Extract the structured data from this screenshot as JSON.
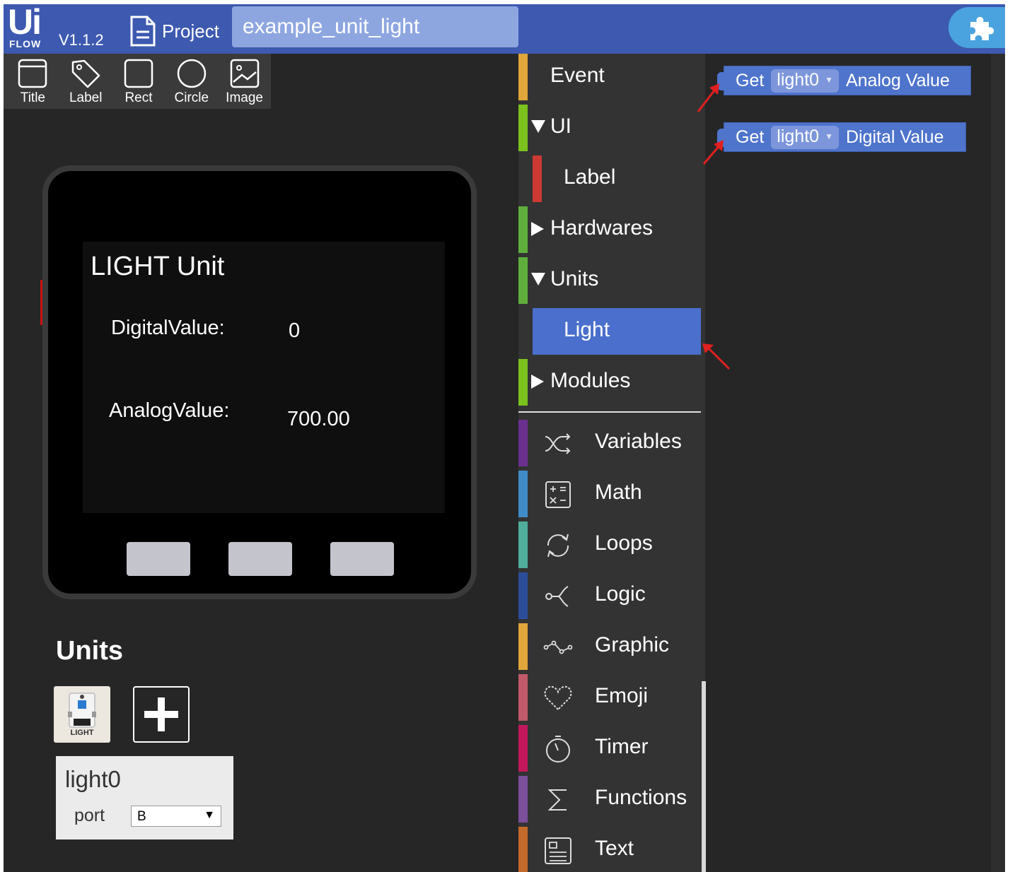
{
  "header": {
    "logo_text": "Ui",
    "logo_sub": "FLOW",
    "version": "V1.1.2",
    "project_label": "Project",
    "project_name": "example_unit_light"
  },
  "components": [
    {
      "label": "Title",
      "icon": "title-icon"
    },
    {
      "label": "Label",
      "icon": "label-tag-icon"
    },
    {
      "label": "Rect",
      "icon": "rect-icon"
    },
    {
      "label": "Circle",
      "icon": "circle-icon"
    },
    {
      "label": "Image",
      "icon": "image-icon"
    }
  ],
  "screen": {
    "title": "LIGHT Unit",
    "digital_label": "DigitalValue:",
    "digital_value": "0",
    "analog_label": "AnalogValue:",
    "analog_value": "700.00"
  },
  "units": {
    "title": "Units",
    "unit_card_label": "LIGHT",
    "instance_name": "light0",
    "port_label": "port",
    "port_value": "B"
  },
  "categories": {
    "event": "Event",
    "ui": "UI",
    "ui_label": "Label",
    "hardwares": "Hardwares",
    "units": "Units",
    "units_light": "Light",
    "modules": "Modules",
    "variables": "Variables",
    "math": "Math",
    "loops": "Loops",
    "logic": "Logic",
    "graphic": "Graphic",
    "emoji": "Emoji",
    "timer": "Timer",
    "functions": "Functions",
    "text": "Text"
  },
  "colors": {
    "event": "#e0a63b",
    "ui": "#7bc21e",
    "label": "#cc3a33",
    "hardwares": "#5fae3c",
    "units": "#5fae3c",
    "modules": "#7bc21e",
    "variables": "#6b2f8f",
    "math": "#3f8bc8",
    "loops": "#4fae9c",
    "logic": "#2c4e9a",
    "graphic": "#e0a63b",
    "emoji": "#c05a6a",
    "timer": "#c2185b",
    "functions": "#7b4f9a",
    "text": "#c46a2a",
    "accent": "#4a6fcc"
  },
  "blocks": [
    {
      "prefix": "Get",
      "dropdown": "light0",
      "suffix": "Analog Value"
    },
    {
      "prefix": "Get",
      "dropdown": "light0",
      "suffix": "Digital Value"
    }
  ]
}
